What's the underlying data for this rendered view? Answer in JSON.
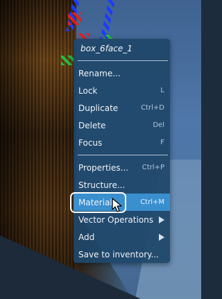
{
  "context_menu": {
    "title": "box_6face_1",
    "items": [
      {
        "label": "Rename...",
        "shortcut": ""
      },
      {
        "label": "Lock",
        "shortcut": "L"
      },
      {
        "label": "Duplicate",
        "shortcut": "Ctrl+D"
      },
      {
        "label": "Delete",
        "shortcut": "Del"
      },
      {
        "label": "Focus",
        "shortcut": "F"
      },
      {
        "label": "Properties...",
        "shortcut": "Ctrl+P"
      },
      {
        "label": "Structure...",
        "shortcut": ""
      },
      {
        "label": "Material...",
        "shortcut": "Ctrl+M",
        "highlighted": true
      },
      {
        "label": "Vector Operations",
        "shortcut": "",
        "submenu": true
      },
      {
        "label": "Add",
        "shortcut": "",
        "submenu": true
      },
      {
        "label": "Save to inventory...",
        "shortcut": ""
      }
    ]
  },
  "colors": {
    "menu_bg": "#1e4669",
    "highlight": "#3a8fcf",
    "text": "#eef3f8"
  }
}
